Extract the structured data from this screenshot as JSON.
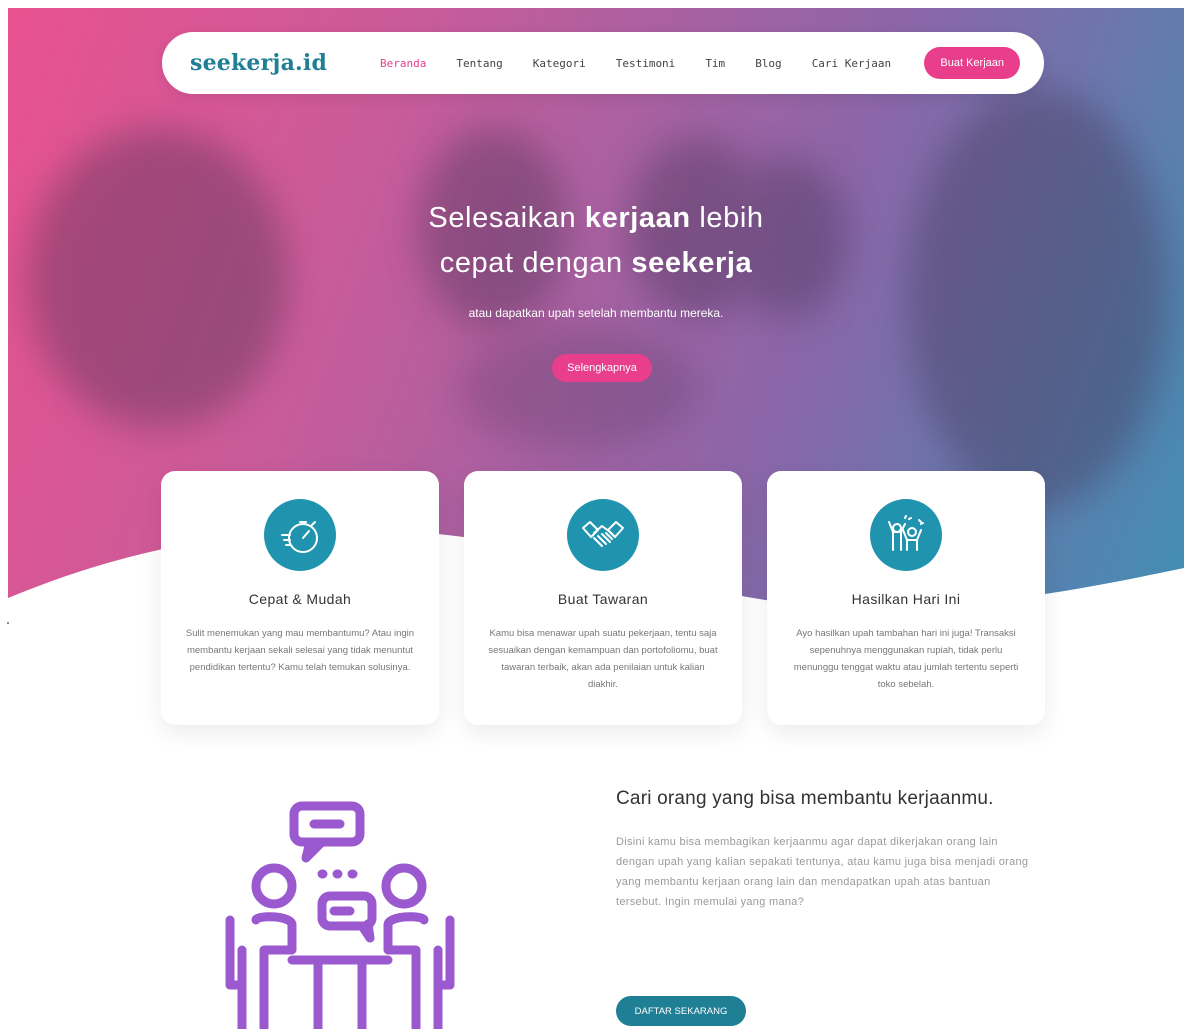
{
  "brand": {
    "logo": "seekerja.id",
    "accent": "#e83e8c",
    "teal": "#1f7f95",
    "icon_bg": "#2094ae",
    "illus_color": "#9b59d0"
  },
  "nav": {
    "items": [
      {
        "label": "Beranda",
        "active": true
      },
      {
        "label": "Tentang"
      },
      {
        "label": "Kategori"
      },
      {
        "label": "Testimoni"
      },
      {
        "label": "Tim"
      },
      {
        "label": "Blog"
      },
      {
        "label": "Cari Kerjaan"
      }
    ],
    "cta": "Buat Kerjaan"
  },
  "hero": {
    "title_line1_pre": "Selesaikan ",
    "title_line1_bold": "kerjaan",
    "title_line1_post": " lebih",
    "title_line2_pre": "cepat dengan ",
    "title_line2_bold": "seekerja",
    "subtitle": "atau dapatkan upah setelah membantu mereka.",
    "button": "Selengkapnya"
  },
  "cards": [
    {
      "icon": "stopwatch-icon",
      "title": "Cepat & Mudah",
      "text": "Sulit menemukan yang mau membantumu? Atau ingin membantu kerjaan sekali selesai yang tidak menuntut pendidikan tertentu? Kamu telah temukan solusinya."
    },
    {
      "icon": "handshake-icon",
      "title": "Buat Tawaran",
      "text": "Kamu bisa menawar upah suatu pekerjaan, tentu saja sesuaikan dengan kemampuan dan portofoliomu, buat tawaran terbaik, akan ada penilaian untuk kalian diakhir."
    },
    {
      "icon": "celebration-icon",
      "title": "Hasilkan Hari Ini",
      "text": "Ayo hasilkan upah tambahan hari ini juga! Transaksi sepenuhnya menggunakan rupiah, tidak perlu menunggu tenggat waktu atau jumlah tertentu seperti toko sebelah."
    }
  ],
  "section": {
    "illustration": "people-talking-icon",
    "title": "Cari orang yang bisa membantu kerjaanmu.",
    "text": "Disini kamu bisa membagikan kerjaanmu agar dapat dikerjakan orang lain dengan upah yang kalian sepakati tentunya, atau kamu juga bisa menjadi orang yang membantu kerjaan orang lain dan mendapatkan upah atas bantuan tersebut. Ingin memulai yang mana?",
    "button": "DAFTAR SEKARANG"
  }
}
